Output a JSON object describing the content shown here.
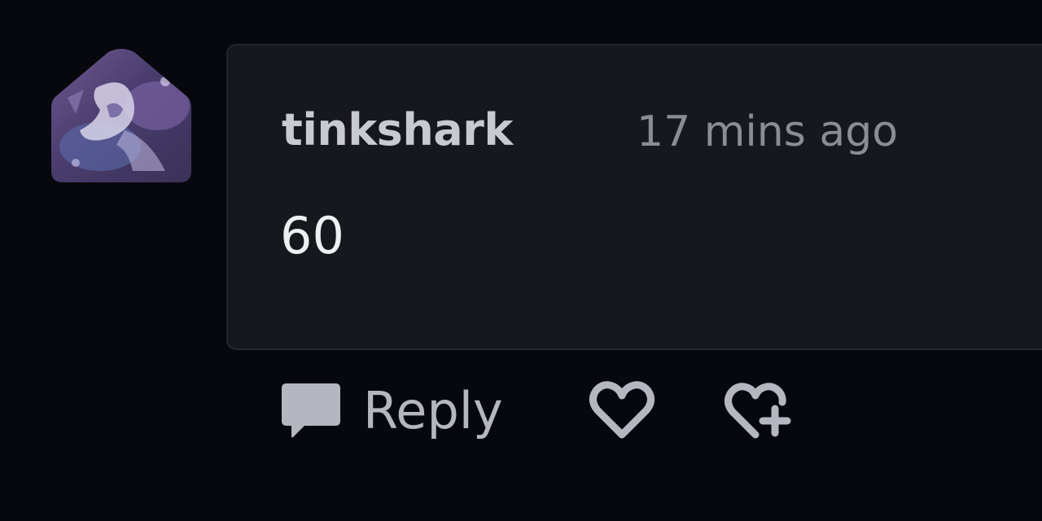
{
  "comment": {
    "username": "tinkshark",
    "timestamp": "17 mins ago",
    "body": "60"
  },
  "actions": {
    "reply_label": "Reply",
    "icons": {
      "reply": "speech-bubble-icon",
      "like": "heart-icon",
      "award": "heart-plus-icon"
    }
  },
  "colors": {
    "page_background": "#07080d",
    "card_background": "#17181d",
    "username": "#c8cad0",
    "timestamp": "#8a8d96",
    "body_text": "#eeeff2",
    "action_icons": "#b4b7bf"
  }
}
